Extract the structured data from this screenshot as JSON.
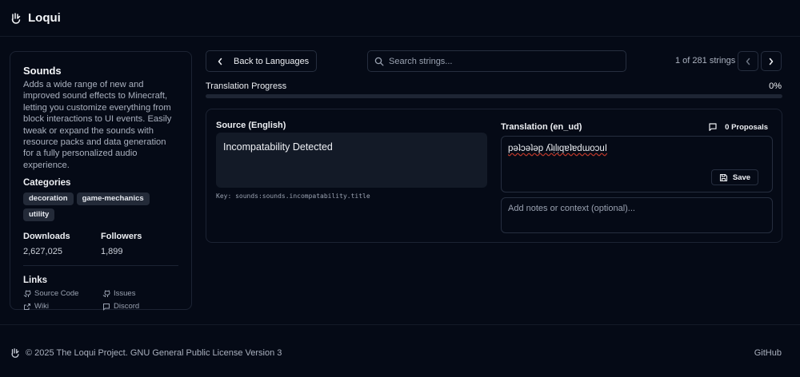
{
  "app": {
    "brand": "Loqui"
  },
  "sidebar": {
    "title": "Sounds",
    "description": "Adds a wide range of new and improved sound effects to Minecraft, letting you customize everything from block interactions to UI events. Easily tweak or expand the sounds with resource packs and data generation for a fully personalized audio experience.",
    "categories_label": "Categories",
    "categories": [
      "decoration",
      "game-mechanics",
      "utility"
    ],
    "downloads_label": "Downloads",
    "downloads": "2,627,025",
    "followers_label": "Followers",
    "followers": "1,899",
    "links_label": "Links",
    "links": [
      {
        "label": "Source Code",
        "icon": "github-icon"
      },
      {
        "label": "Issues",
        "icon": "github-icon"
      },
      {
        "label": "Wiki",
        "icon": "external-link-icon"
      },
      {
        "label": "Discord",
        "icon": "chat-icon"
      }
    ]
  },
  "toolbar": {
    "back_label": "Back to Languages",
    "search_placeholder": "Search strings...",
    "count_text": "1 of 281 strings"
  },
  "progress": {
    "label": "Translation Progress",
    "percent_text": "0%",
    "value_percent": 0
  },
  "editor": {
    "source_label": "Source (English)",
    "source_text": "Incompatability Detected",
    "key_text": "Key: sounds:sounds.incompatability.title",
    "translation_label": "Translation (en_ud)",
    "proposals_label": "0 Proposals",
    "translation_value": "pǝʇɔǝʇǝp ʎʇᴉlᴉqɐʇɐdɯoɔuI",
    "save_label": "Save",
    "notes_placeholder": "Add notes or context (optional)..."
  },
  "footer": {
    "copyright": "© 2025 The Loqui Project. GNU General Public License Version 3",
    "github_label": "GitHub"
  },
  "colors": {
    "background": "#050a16",
    "border": "#1c2333",
    "tag_bg": "#232a38",
    "spell_error": "#c0392b"
  }
}
